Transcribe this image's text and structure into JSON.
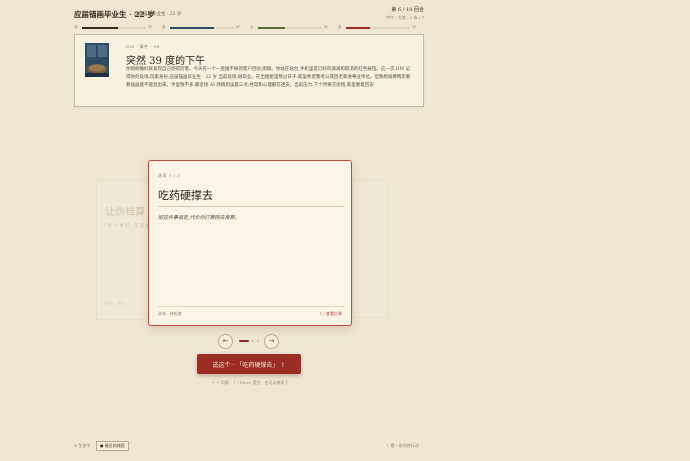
{
  "header": {
    "title": "应届锚画毕业生 · 22 岁",
    "subtitle": "应届锚画毕业生 · 22 岁",
    "turn": "第 6 / 10 回合",
    "turn_sub": "中午 · 大势 · 3 市 / 7"
  },
  "stats": [
    {
      "name": "钱",
      "value": "50",
      "level": 0.56,
      "color": "#3a2a1e"
    },
    {
      "name": "身",
      "value": "69",
      "level": 0.69,
      "color": "#2f4a63"
    },
    {
      "name": "心",
      "value": "42",
      "level": 0.42,
      "color": "#5a6b3a"
    },
    {
      "name": "名",
      "value": "38",
      "level": 0.38,
      "color": "#9a2e24"
    }
  ],
  "event": {
    "meta": "DM · 事件 · 06",
    "title": "突然 39 度的下午",
    "body": "你刚刚做好就发现自己烧得厉害。今天有一个一直推不掉的客户回访,刚刚。你站在站台,手机里是订好的滴滴和取消的红色按钮。这一次,DM 记得你的处境:玩家身份:应届锚画毕业生 · 22 岁 当前处境:刚毕业。在出租屋里熬过日子,家里希望我考公或回老家进事业单位。但我想再撑两年看看插画能不能混出来。手里钱不多,最近接 AI 改稿到凌晨三点,经常和心理都在透支。当前压力:下个月要交房租,家里催着回去"
  },
  "ghost_left": {
    "title": "让伤档算",
    "text": "“请 个 事 假 , 在 家 躺",
    "foot": "状态 · 逐伤"
  },
  "choice": {
    "number": "选项 1 / 3",
    "title": "吃药硬撑去",
    "description": "把这件事搞定,代价你打算回去再算。",
    "footer_left": "未知 · 待检查",
    "footer_right": "↑ / 查看后果"
  },
  "nav": {
    "prev_icon": "←",
    "next_icon": "→"
  },
  "confirm": {
    "label": "选这个 · 「吃药硬撑去」 ↑"
  },
  "hint": "← → 切换 · ↑ / Enter 提交 · 也可以继续下",
  "footer": {
    "left_label": "⊙ 生命平",
    "chip_label": "● 能见的线程",
    "right_label": "↓ 看一份你的行动"
  }
}
